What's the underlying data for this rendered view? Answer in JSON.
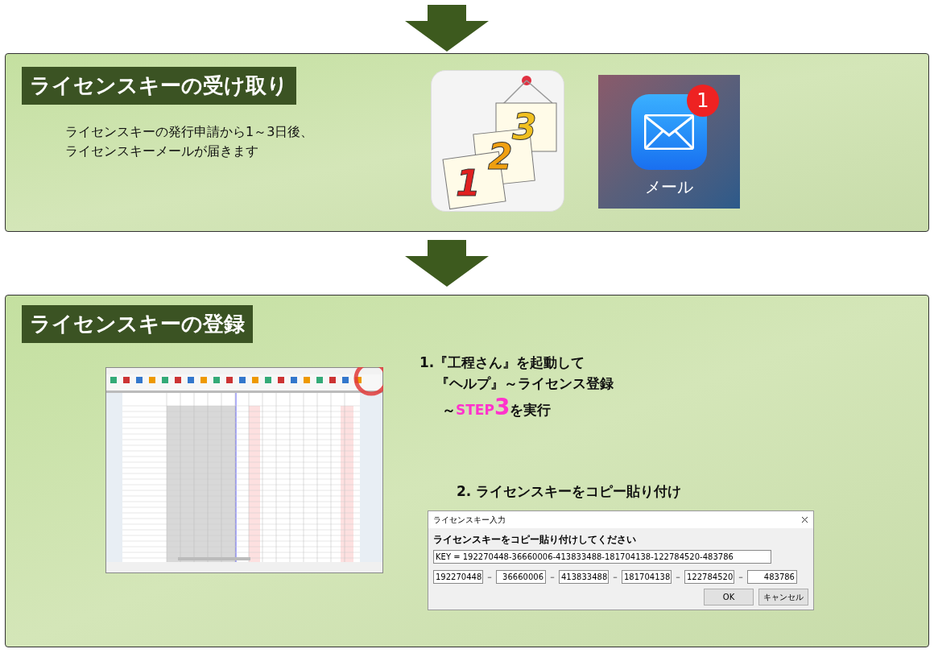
{
  "section_receive": {
    "title": "ライセンスキーの受け取り",
    "lines": [
      "ライセンスキーの発行申請から1～3日後、",
      "ライセンスキーメールが届きます"
    ],
    "calendar_pages": [
      "1",
      "2",
      "3"
    ],
    "mail_app": {
      "label": "メール",
      "badge": "1"
    }
  },
  "section_register": {
    "title": "ライセンスキーの登録",
    "step1": {
      "lines": [
        "1.『工程さん』を起動して",
        "『ヘルプ』～ライセンス登録"
      ],
      "prefix": "～",
      "step_word": "STEP",
      "step_number": "3",
      "suffix": "を実行"
    },
    "step2": "2. ライセンスキーをコピー貼り付け",
    "dialog": {
      "title": "ライセンスキー入力",
      "prompt": "ライセンスキーをコピー貼り付けしてください",
      "key_value": "KEY = 192270448-36660006-413833488-181704138-122784520-483786",
      "segments": [
        "192270448",
        "36660006",
        "413833488",
        "181704138",
        "122784520",
        "483786"
      ],
      "separator": "－",
      "buttons": [
        "OK",
        "キャンセル"
      ]
    }
  }
}
